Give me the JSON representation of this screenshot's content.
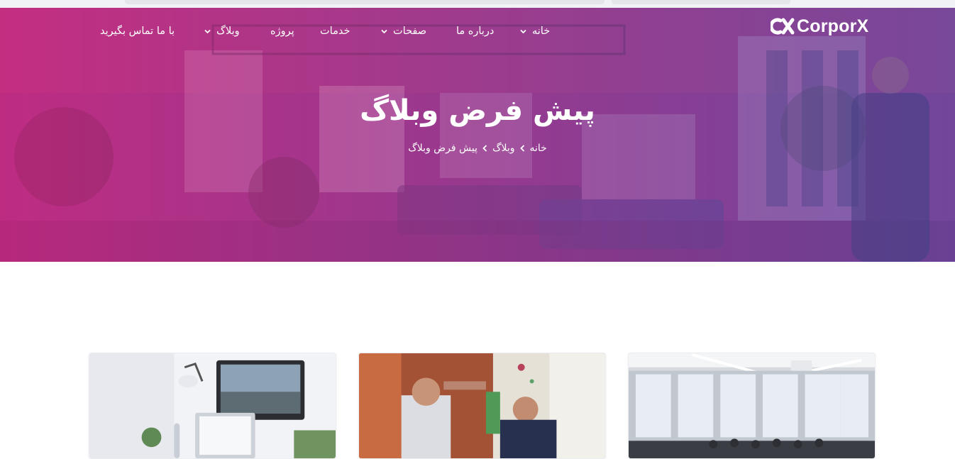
{
  "brand": {
    "logo_text": "CorporX",
    "accent": "#e3207a",
    "secondary": "#4f57a9"
  },
  "nav": {
    "home": "خانه",
    "about": "درباره ما",
    "pages": "صفحات",
    "services": "خدمات",
    "project": "پروژه",
    "blog": "وبلاگ",
    "contact": "با ما تماس بگیرید"
  },
  "hero": {
    "title": "پیش فرض وبلاگ",
    "breadcrumb": [
      "خانه",
      "وبلاگ",
      "پیش فرض وبلاگ"
    ]
  },
  "icons": {
    "dropdown": "chevron-down-icon",
    "breadcrumb_separator": "chevron-left-icon"
  },
  "cards": [
    {
      "image": "office-desk-computer-photo"
    },
    {
      "image": "business-high-five-photo"
    },
    {
      "image": "conference-room-meeting-photo"
    }
  ]
}
